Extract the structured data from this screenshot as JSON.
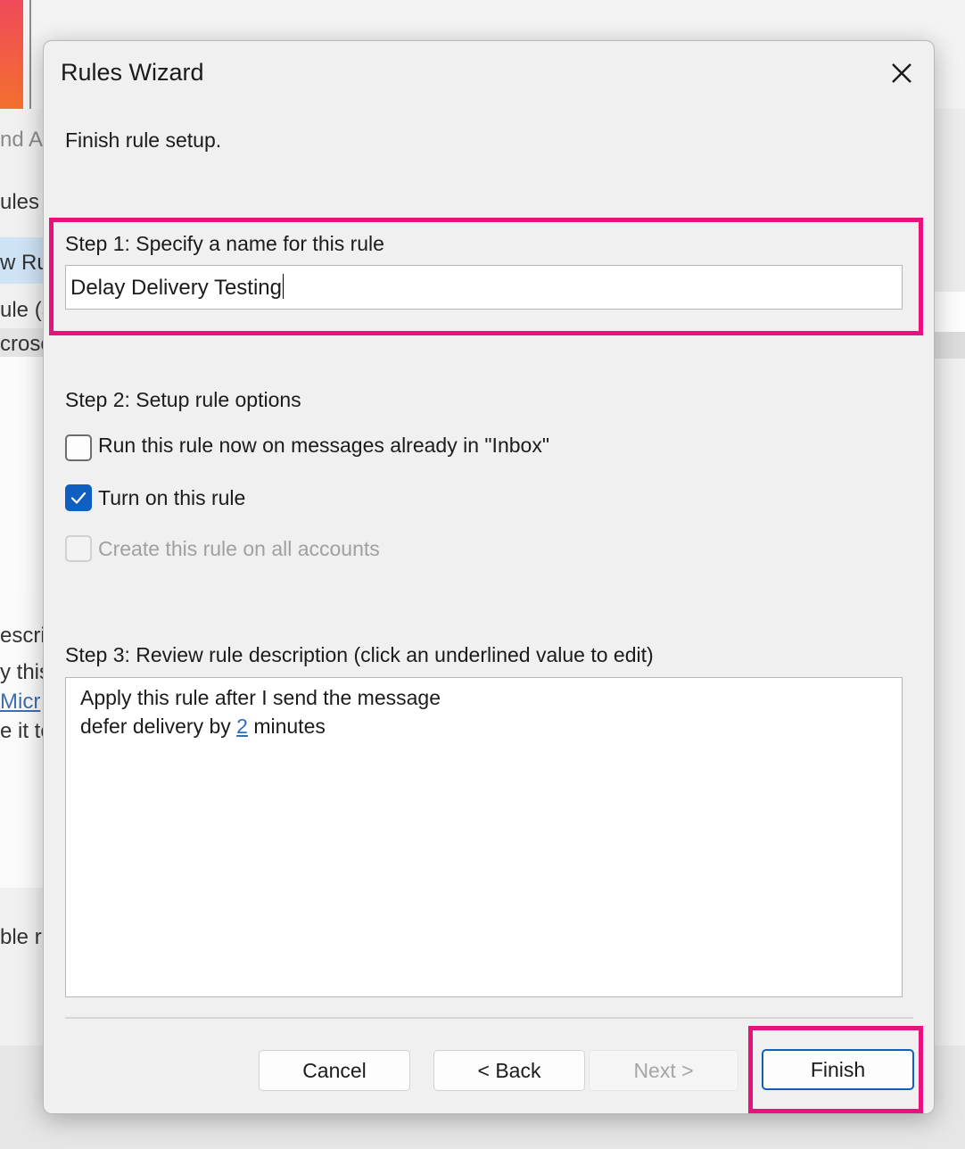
{
  "background": {
    "fragments": [
      {
        "text": "nd A",
        "style": "gray"
      },
      {
        "text": "ules",
        "style": ""
      },
      {
        "text": "w Ru",
        "style": ""
      },
      {
        "text": "ule (a",
        "style": ""
      },
      {
        "text": "crosc",
        "style": ""
      },
      {
        "text": "escrip",
        "style": ""
      },
      {
        "text": "y this",
        "style": ""
      },
      {
        "text": "Micr",
        "style": "link"
      },
      {
        "text": "e it to",
        "style": ""
      },
      {
        "text": "ble r",
        "style": ""
      }
    ]
  },
  "dialog": {
    "title": "Rules Wizard",
    "close_icon": "close-icon",
    "header": "Finish rule setup.",
    "step1": {
      "label": "Step 1: Specify a name for this rule",
      "value": "Delay Delivery Testing"
    },
    "step2": {
      "label": "Step 2: Setup rule options",
      "options": [
        {
          "label": "Run this rule now on messages already in \"Inbox\"",
          "checked": false,
          "enabled": true
        },
        {
          "label": "Turn on this rule",
          "checked": true,
          "enabled": true
        },
        {
          "label": "Create this rule on all accounts",
          "checked": false,
          "enabled": false
        }
      ]
    },
    "step3": {
      "label": "Step 3: Review rule description (click an underlined value to edit)",
      "line1": "Apply this rule after I send the message",
      "line2_prefix": "defer delivery by ",
      "line2_link": "2",
      "line2_suffix": " minutes"
    },
    "buttons": {
      "cancel": "Cancel",
      "back": "< Back",
      "next": "Next >",
      "finish": "Finish"
    },
    "colors": {
      "highlight": "#e8127c",
      "accent": "#0f5ec1"
    }
  }
}
